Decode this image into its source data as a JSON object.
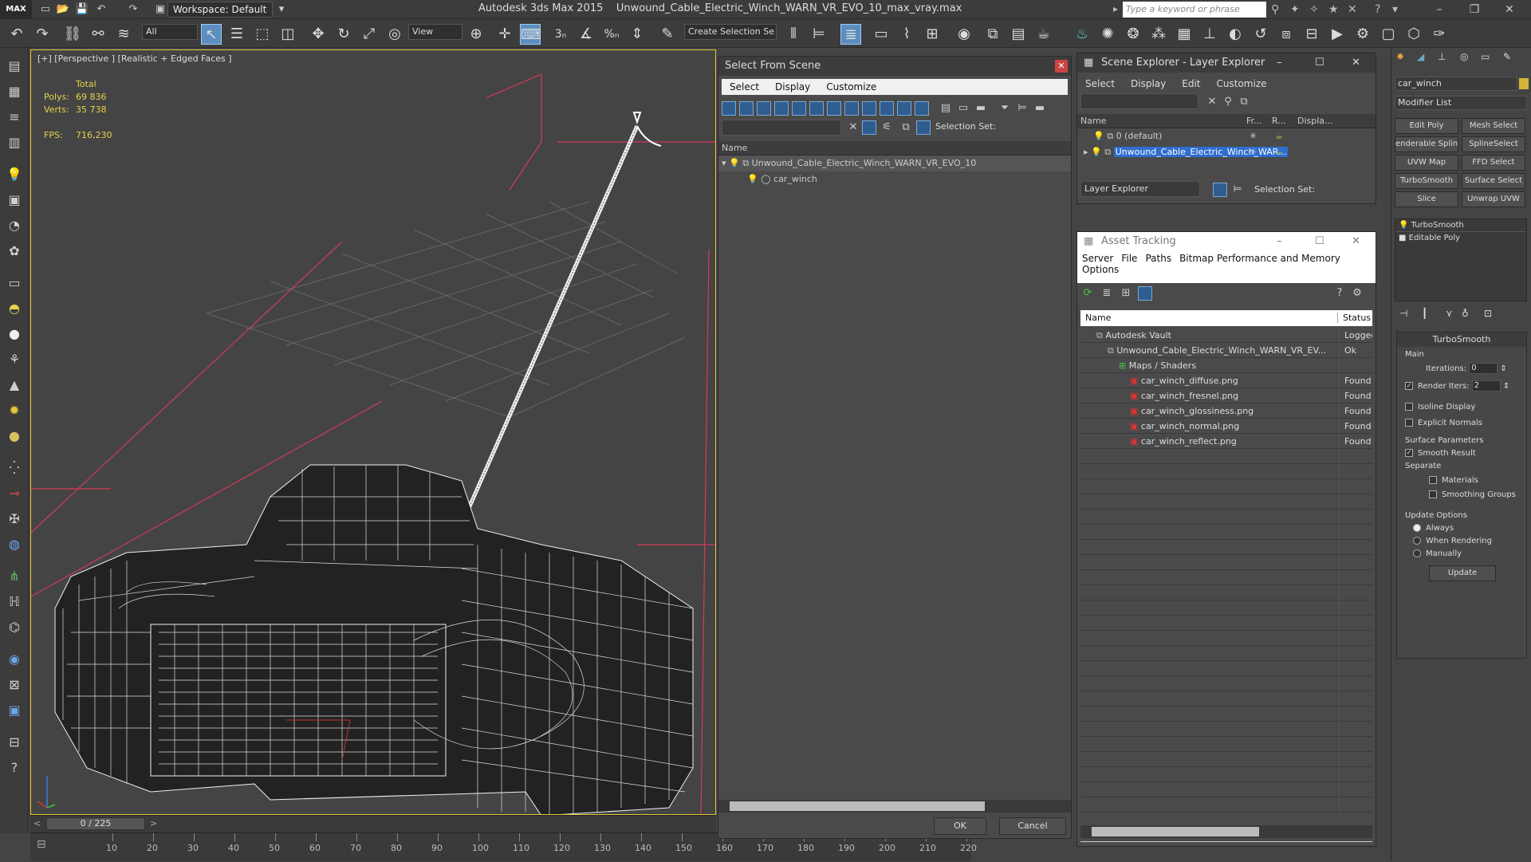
{
  "app": {
    "logo": "MAX",
    "title": "Autodesk 3ds Max  2015",
    "filename": "Unwound_Cable_Electric_Winch_WARN_VR_EVO_10_max_vray.max",
    "workspace": "Workspace: Default",
    "search_placeholder": "Type a keyword or phrase"
  },
  "toolbar": {
    "filter": "All",
    "refcoord": "View",
    "named_selection": "Create Selection Se",
    "snap_3": "3",
    "percent": "%"
  },
  "viewport": {
    "label": "[+] [Perspective ] [Realistic + Edged Faces ]",
    "stats_total": "Total",
    "polys_label": "Polys:",
    "polys_value": "69 836",
    "verts_label": "Verts:",
    "verts_value": "35 738",
    "fps_label": "FPS:",
    "fps_value": "716,230"
  },
  "timeline": {
    "frame": "0 / 225",
    "ticks": [
      "10",
      "20",
      "30",
      "40",
      "50",
      "60",
      "70",
      "80",
      "90",
      "100",
      "110",
      "120",
      "130",
      "140",
      "150",
      "160",
      "170",
      "180",
      "190",
      "200",
      "210",
      "220"
    ]
  },
  "select_from_scene": {
    "title": "Select From Scene",
    "menu": [
      "Select",
      "Display",
      "Customize"
    ],
    "selection_set_label": "Selection Set:",
    "col_name": "Name",
    "tree": [
      {
        "label": "Unwound_Cable_Electric_Winch_WARN_VR_EVO_10",
        "level": 0
      },
      {
        "label": "car_winch",
        "level": 1
      }
    ],
    "ok": "OK",
    "cancel": "Cancel"
  },
  "scene_explorer": {
    "title": "Scene Explorer - Layer Explorer",
    "menu": [
      "Select",
      "Display",
      "Edit",
      "Customize"
    ],
    "cols": [
      "Name",
      "Fr...",
      "R...",
      "Displa..."
    ],
    "rows": [
      {
        "label": "0 (default)"
      },
      {
        "label": "Unwound_Cable_Electric_Winch_WAR..."
      }
    ],
    "footer_dropdown": "Layer Explorer",
    "selection_set_label": "Selection Set:"
  },
  "asset_tracking": {
    "title": "Asset Tracking",
    "menu": [
      "Server",
      "File",
      "Paths",
      "Bitmap Performance and Memory"
    ],
    "menu2": "Options",
    "col_name": "Name",
    "col_status": "Status",
    "rows": [
      {
        "name": "Autodesk Vault",
        "status": "Logged",
        "level": 0
      },
      {
        "name": "Unwound_Cable_Electric_Winch_WARN_VR_EV...",
        "status": "Ok",
        "level": 1
      },
      {
        "name": "Maps / Shaders",
        "status": "",
        "level": 2
      },
      {
        "name": "car_winch_diffuse.png",
        "status": "Found",
        "level": 3
      },
      {
        "name": "car_winch_fresnel.png",
        "status": "Found",
        "level": 3
      },
      {
        "name": "car_winch_glossiness.png",
        "status": "Found",
        "level": 3
      },
      {
        "name": "car_winch_normal.png",
        "status": "Found",
        "level": 3
      },
      {
        "name": "car_winch_reflect.png",
        "status": "Found",
        "level": 3
      }
    ]
  },
  "command_panel": {
    "object_name": "car_winch",
    "modifier_list": "Modifier List",
    "mod_buttons": [
      "Edit Poly",
      "Mesh Select",
      "enderable Splin",
      "SplineSelect",
      "UVW Map",
      "FFD Select",
      "TurboSmooth",
      "Surface Select",
      "Slice",
      "Unwrap UVW"
    ],
    "stack": [
      "TurboSmooth",
      "Editable Poly"
    ],
    "rollout_title": "TurboSmooth",
    "main": "Main",
    "iterations_label": "Iterations:",
    "iterations": "0",
    "render_iters_label": "Render Iters:",
    "render_iters": "2",
    "isoline": "Isoline Display",
    "explicit_normals": "Explicit Normals",
    "surface_params": "Surface Parameters",
    "smooth_result": "Smooth Result",
    "separate": "Separate",
    "materials": "Materials",
    "smoothing_groups": "Smoothing Groups",
    "update_options": "Update Options",
    "always": "Always",
    "when_rendering": "When Rendering",
    "manually": "Manually",
    "update": "Update"
  }
}
